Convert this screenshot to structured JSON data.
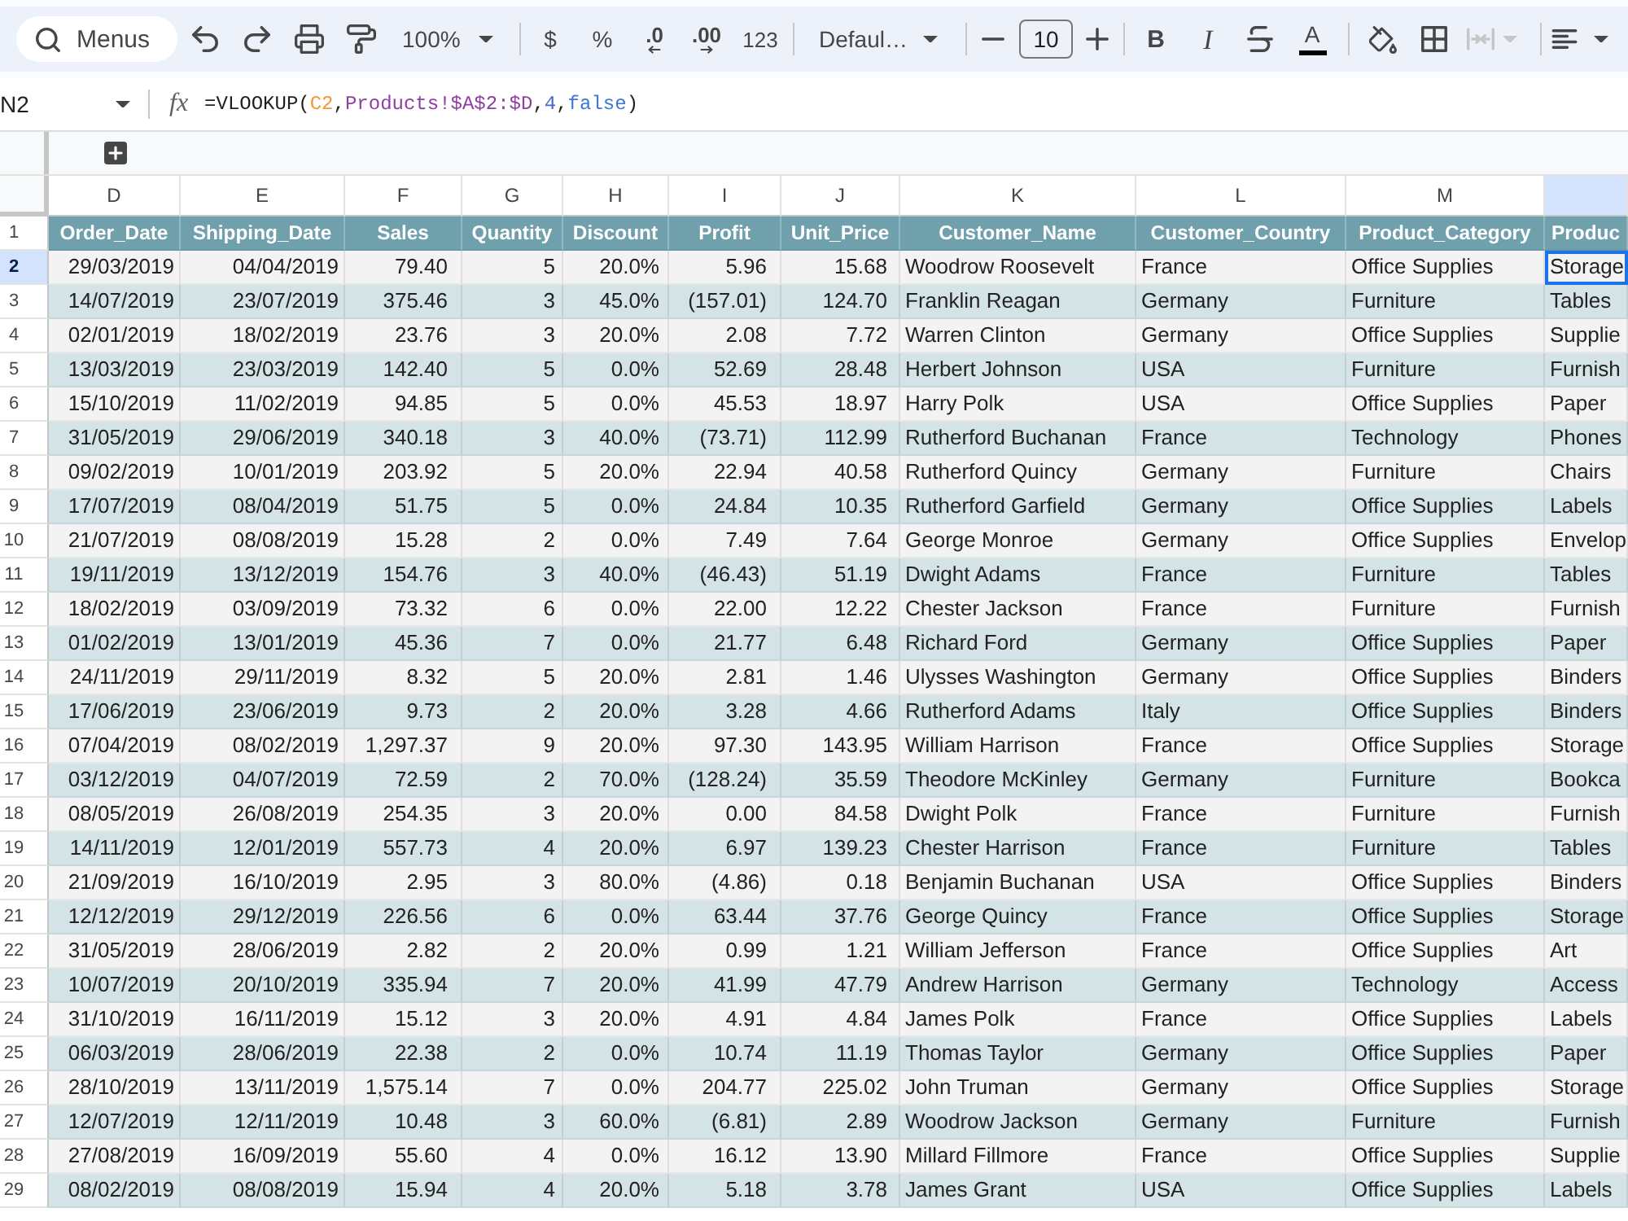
{
  "toolbar": {
    "search": {
      "label": "Menus"
    },
    "zoom": "100%",
    "currency": "$",
    "percent": "%",
    "decrease_decimal": ".0",
    "increase_decimal": ".00",
    "more_formats": "123",
    "font": "Defaul…",
    "font_size": "10",
    "bold": "B",
    "italic": "I",
    "text_color": "A",
    "merge_cells": {
      "disabled": true
    }
  },
  "formula_bar": {
    "cell_reference": "N2",
    "function_label": "fx",
    "formula": [
      {
        "text": "=VLOOKUP(",
        "kind": "plain"
      },
      {
        "text": "C2",
        "kind": "ref"
      },
      {
        "text": ",",
        "kind": "plain"
      },
      {
        "text": "Products!$A$2:$D",
        "kind": "range"
      },
      {
        "text": ",",
        "kind": "plain"
      },
      {
        "text": "4",
        "kind": "number"
      },
      {
        "text": ",",
        "kind": "plain"
      },
      {
        "text": "false",
        "kind": "keyword"
      },
      {
        "text": ")",
        "kind": "plain"
      }
    ]
  },
  "grid": {
    "columns": [
      {
        "letter": "D",
        "selected": false
      },
      {
        "letter": "E",
        "selected": false
      },
      {
        "letter": "F",
        "selected": false
      },
      {
        "letter": "G",
        "selected": false
      },
      {
        "letter": "H",
        "selected": false
      },
      {
        "letter": "I",
        "selected": false
      },
      {
        "letter": "J",
        "selected": false
      },
      {
        "letter": "K",
        "selected": false
      },
      {
        "letter": "L",
        "selected": false
      },
      {
        "letter": "M",
        "selected": false
      },
      {
        "selected": true
      }
    ],
    "rows": [
      {
        "number": "1",
        "kind": "header",
        "selected": false,
        "cells": [
          "Order_Date",
          "Shipping_Date",
          "Sales",
          "Quantity",
          "Discount",
          "Profit",
          "Unit_Price",
          "Customer_Name",
          "Customer_Country",
          "Product_Category",
          "Produc"
        ]
      },
      {
        "number": "2",
        "kind": "data",
        "selected": true,
        "cells": [
          "29/03/2019",
          "04/04/2019",
          "79.40",
          "5",
          "20.0%",
          "5.96",
          "15.68",
          "Woodrow Roosevelt",
          "France",
          "Office Supplies",
          "Storage"
        ]
      },
      {
        "number": "3",
        "kind": "data",
        "selected": false,
        "cells": [
          "14/07/2019",
          "23/07/2019",
          "375.46",
          "3",
          "45.0%",
          "(157.01)",
          "124.70",
          "Franklin Reagan",
          "Germany",
          "Furniture",
          "Tables"
        ]
      },
      {
        "number": "4",
        "kind": "data",
        "selected": false,
        "cells": [
          "02/01/2019",
          "18/02/2019",
          "23.76",
          "3",
          "20.0%",
          "2.08",
          "7.72",
          "Warren Clinton",
          "Germany",
          "Office Supplies",
          "Supplie"
        ]
      },
      {
        "number": "5",
        "kind": "data",
        "selected": false,
        "cells": [
          "13/03/2019",
          "23/03/2019",
          "142.40",
          "5",
          "0.0%",
          "52.69",
          "28.48",
          "Herbert Johnson",
          "USA",
          "Furniture",
          "Furnish"
        ]
      },
      {
        "number": "6",
        "kind": "data",
        "selected": false,
        "cells": [
          "15/10/2019",
          "11/02/2019",
          "94.85",
          "5",
          "0.0%",
          "45.53",
          "18.97",
          "Harry Polk",
          "USA",
          "Office Supplies",
          "Paper"
        ]
      },
      {
        "number": "7",
        "kind": "data",
        "selected": false,
        "cells": [
          "31/05/2019",
          "29/06/2019",
          "340.18",
          "3",
          "40.0%",
          "(73.71)",
          "112.99",
          "Rutherford Buchanan",
          "France",
          "Technology",
          "Phones"
        ]
      },
      {
        "number": "8",
        "kind": "data",
        "selected": false,
        "cells": [
          "09/02/2019",
          "10/01/2019",
          "203.92",
          "5",
          "20.0%",
          "22.94",
          "40.58",
          "Rutherford Quincy",
          "Germany",
          "Furniture",
          "Chairs"
        ]
      },
      {
        "number": "9",
        "kind": "data",
        "selected": false,
        "cells": [
          "17/07/2019",
          "08/04/2019",
          "51.75",
          "5",
          "0.0%",
          "24.84",
          "10.35",
          "Rutherford Garfield",
          "Germany",
          "Office Supplies",
          "Labels"
        ]
      },
      {
        "number": "10",
        "kind": "data",
        "selected": false,
        "cells": [
          "21/07/2019",
          "08/08/2019",
          "15.28",
          "2",
          "0.0%",
          "7.49",
          "7.64",
          "George Monroe",
          "Germany",
          "Office Supplies",
          "Envelop"
        ]
      },
      {
        "number": "11",
        "kind": "data",
        "selected": false,
        "cells": [
          "19/11/2019",
          "13/12/2019",
          "154.76",
          "3",
          "40.0%",
          "(46.43)",
          "51.19",
          "Dwight Adams",
          "France",
          "Furniture",
          "Tables"
        ]
      },
      {
        "number": "12",
        "kind": "data",
        "selected": false,
        "cells": [
          "18/02/2019",
          "03/09/2019",
          "73.32",
          "6",
          "0.0%",
          "22.00",
          "12.22",
          "Chester Jackson",
          "France",
          "Furniture",
          "Furnish"
        ]
      },
      {
        "number": "13",
        "kind": "data",
        "selected": false,
        "cells": [
          "01/02/2019",
          "13/01/2019",
          "45.36",
          "7",
          "0.0%",
          "21.77",
          "6.48",
          "Richard Ford",
          "Germany",
          "Office Supplies",
          "Paper"
        ]
      },
      {
        "number": "14",
        "kind": "data",
        "selected": false,
        "cells": [
          "24/11/2019",
          "29/11/2019",
          "8.32",
          "5",
          "20.0%",
          "2.81",
          "1.46",
          "Ulysses Washington",
          "Germany",
          "Office Supplies",
          "Binders"
        ]
      },
      {
        "number": "15",
        "kind": "data",
        "selected": false,
        "cells": [
          "17/06/2019",
          "23/06/2019",
          "9.73",
          "2",
          "20.0%",
          "3.28",
          "4.66",
          "Rutherford Adams",
          "Italy",
          "Office Supplies",
          "Binders"
        ]
      },
      {
        "number": "16",
        "kind": "data",
        "selected": false,
        "cells": [
          "07/04/2019",
          "08/02/2019",
          "1,297.37",
          "9",
          "20.0%",
          "97.30",
          "143.95",
          "William Harrison",
          "France",
          "Office Supplies",
          "Storage"
        ]
      },
      {
        "number": "17",
        "kind": "data",
        "selected": false,
        "cells": [
          "03/12/2019",
          "04/07/2019",
          "72.59",
          "2",
          "70.0%",
          "(128.24)",
          "35.59",
          "Theodore McKinley",
          "Germany",
          "Furniture",
          "Bookca"
        ]
      },
      {
        "number": "18",
        "kind": "data",
        "selected": false,
        "cells": [
          "08/05/2019",
          "26/08/2019",
          "254.35",
          "3",
          "20.0%",
          "0.00",
          "84.58",
          "Dwight Polk",
          "France",
          "Furniture",
          "Furnish"
        ]
      },
      {
        "number": "19",
        "kind": "data",
        "selected": false,
        "cells": [
          "14/11/2019",
          "12/01/2019",
          "557.73",
          "4",
          "20.0%",
          "6.97",
          "139.23",
          "Chester Harrison",
          "France",
          "Furniture",
          "Tables"
        ]
      },
      {
        "number": "20",
        "kind": "data",
        "selected": false,
        "cells": [
          "21/09/2019",
          "16/10/2019",
          "2.95",
          "3",
          "80.0%",
          "(4.86)",
          "0.18",
          "Benjamin Buchanan",
          "USA",
          "Office Supplies",
          "Binders"
        ]
      },
      {
        "number": "21",
        "kind": "data",
        "selected": false,
        "cells": [
          "12/12/2019",
          "29/12/2019",
          "226.56",
          "6",
          "0.0%",
          "63.44",
          "37.76",
          "George Quincy",
          "France",
          "Office Supplies",
          "Storage"
        ]
      },
      {
        "number": "22",
        "kind": "data",
        "selected": false,
        "cells": [
          "31/05/2019",
          "28/06/2019",
          "2.82",
          "2",
          "20.0%",
          "0.99",
          "1.21",
          "William Jefferson",
          "France",
          "Office Supplies",
          "Art"
        ]
      },
      {
        "number": "23",
        "kind": "data",
        "selected": false,
        "cells": [
          "10/07/2019",
          "20/10/2019",
          "335.94",
          "7",
          "20.0%",
          "41.99",
          "47.79",
          "Andrew Harrison",
          "Germany",
          "Technology",
          "Access"
        ]
      },
      {
        "number": "24",
        "kind": "data",
        "selected": false,
        "cells": [
          "31/10/2019",
          "16/11/2019",
          "15.12",
          "3",
          "20.0%",
          "4.91",
          "4.84",
          "James Polk",
          "France",
          "Office Supplies",
          "Labels"
        ]
      },
      {
        "number": "25",
        "kind": "data",
        "selected": false,
        "cells": [
          "06/03/2019",
          "28/06/2019",
          "22.38",
          "2",
          "0.0%",
          "10.74",
          "11.19",
          "Thomas Taylor",
          "Germany",
          "Office Supplies",
          "Paper"
        ]
      },
      {
        "number": "26",
        "kind": "data",
        "selected": false,
        "cells": [
          "28/10/2019",
          "13/11/2019",
          "1,575.14",
          "7",
          "0.0%",
          "204.77",
          "225.02",
          "John Truman",
          "Germany",
          "Office Supplies",
          "Storage"
        ]
      },
      {
        "number": "27",
        "kind": "data",
        "selected": false,
        "cells": [
          "12/07/2019",
          "12/11/2019",
          "10.48",
          "3",
          "60.0%",
          "(6.81)",
          "2.89",
          "Woodrow Jackson",
          "Germany",
          "Furniture",
          "Furnish"
        ]
      },
      {
        "number": "28",
        "kind": "data",
        "selected": false,
        "cells": [
          "27/08/2019",
          "16/09/2019",
          "55.60",
          "4",
          "0.0%",
          "16.12",
          "13.90",
          "Millard Fillmore",
          "France",
          "Office Supplies",
          "Supplie"
        ]
      },
      {
        "number": "29",
        "kind": "data",
        "selected": false,
        "cells": [
          "08/02/2019",
          "08/08/2019",
          "15.94",
          "4",
          "20.0%",
          "5.18",
          "3.78",
          "James Grant",
          "USA",
          "Office Supplies",
          "Labels"
        ]
      }
    ]
  }
}
